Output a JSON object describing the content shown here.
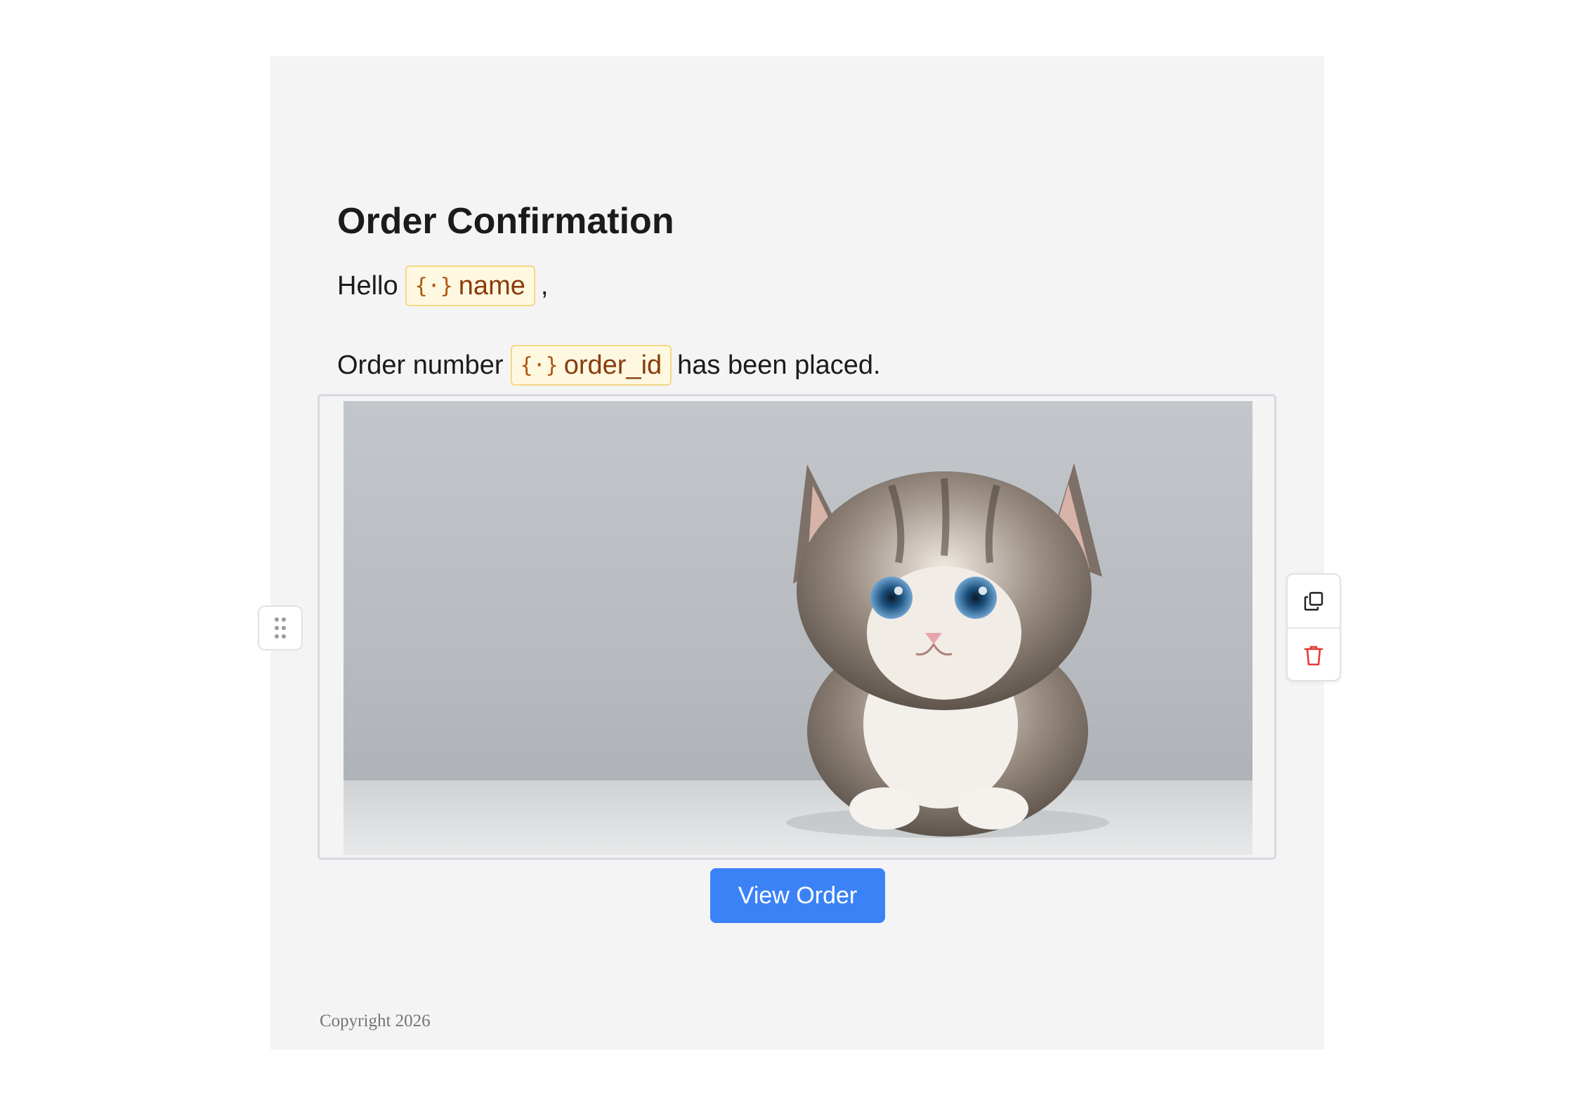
{
  "email": {
    "title": "Order Confirmation",
    "greeting": {
      "prefix": "Hello",
      "variable": "name",
      "suffix": ","
    },
    "order_line": {
      "prefix": "Order number",
      "variable": "order_id",
      "suffix": "has been placed."
    },
    "image": {
      "subject": "kitten-photo"
    },
    "button_label": "View Order",
    "copyright": "Copyright 2026"
  },
  "toolbar": {
    "drag_icon": "drag-handle-icon",
    "copy_icon": "copy-icon",
    "delete_icon": "trash-icon"
  },
  "colors": {
    "canvas_bg": "#f4f4f4",
    "button": "#3b82f6",
    "chip_bg": "#fff8e1",
    "chip_border": "#f5d784",
    "chip_text": "#8a3c0c",
    "delete": "#e53935"
  }
}
